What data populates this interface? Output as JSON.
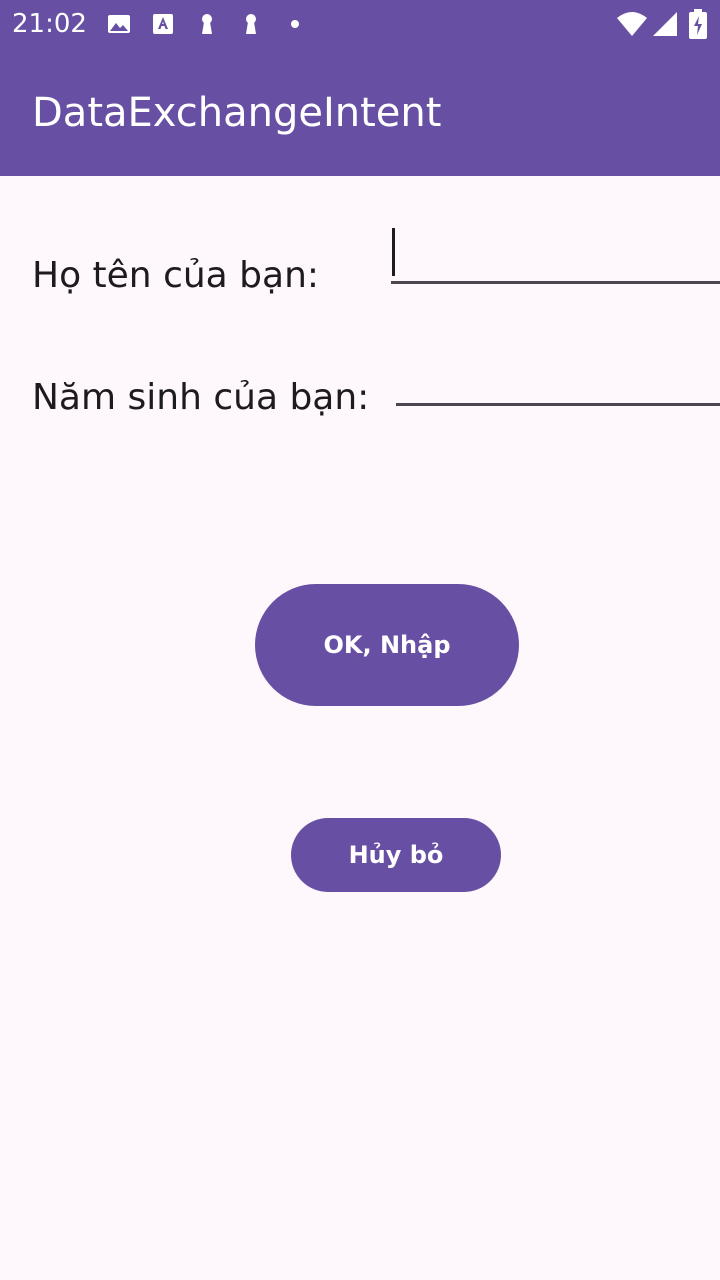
{
  "status_bar": {
    "time": "21:02",
    "left_icons": [
      "image-icon",
      "font-download-icon",
      "keyhole-icon",
      "keyhole-icon",
      "dot-icon"
    ],
    "right_icons": [
      "wifi-icon",
      "cell-signal-icon",
      "battery-icon"
    ]
  },
  "app_bar": {
    "title": "DataExchangeIntent"
  },
  "form": {
    "name_label": "Họ tên của bạn:",
    "name_value": "",
    "year_label": "Năm sinh của bạn:",
    "year_value": ""
  },
  "buttons": {
    "ok_label": "OK, Nhập",
    "cancel_label": "Hủy bỏ"
  },
  "colors": {
    "primary": "#6750a4",
    "background": "#fef7fc",
    "on_primary": "#ffffff",
    "text": "#1d1b20",
    "underline": "#4b4650"
  }
}
